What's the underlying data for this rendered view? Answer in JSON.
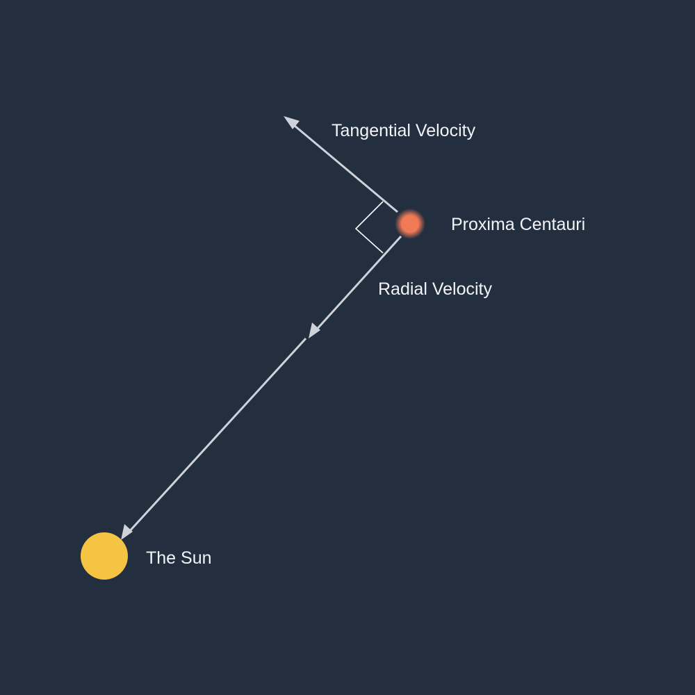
{
  "labels": {
    "tangential": "Tangential Velocity",
    "star": "Proxima Centauri",
    "radial": "Radial Velocity",
    "sun": "The Sun"
  },
  "colors": {
    "background": "#232e3f",
    "star": "#f07a56",
    "sun": "#f5c443",
    "arrows": "#cfd3d9",
    "text": "#f2f4f7"
  }
}
